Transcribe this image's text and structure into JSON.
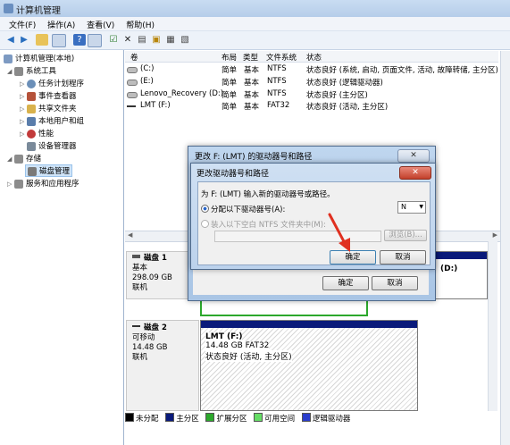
{
  "app": {
    "title": "计算机管理"
  },
  "menu": [
    "文件(F)",
    "操作(A)",
    "查看(V)",
    "帮助(H)"
  ],
  "tree": {
    "root": "计算机管理(本地)",
    "system_tools": "系统工具",
    "items": [
      "任务计划程序",
      "事件查看器",
      "共享文件夹",
      "本地用户和组",
      "性能",
      "设备管理器"
    ],
    "storage": "存储",
    "disk_mgmt": "磁盘管理",
    "services": "服务和应用程序"
  },
  "volumes": {
    "headers": [
      "卷",
      "布局",
      "类型",
      "文件系统",
      "状态"
    ],
    "rows": [
      [
        "(C:)",
        "简单",
        "基本",
        "NTFS",
        "状态良好 (系统, 启动, 页面文件, 活动, 故障转储, 主分区)"
      ],
      [
        "(E:)",
        "简单",
        "基本",
        "NTFS",
        "状态良好 (逻辑驱动器)"
      ],
      [
        "Lenovo_Recovery (D:)",
        "简单",
        "基本",
        "NTFS",
        "状态良好 (主分区)"
      ],
      [
        "LMT (F:)",
        "简单",
        "基本",
        "FAT32",
        "状态良好 (活动, 主分区)"
      ]
    ]
  },
  "disks": [
    {
      "name": "磁盘 1",
      "type": "基本",
      "size": "298.09 GB",
      "status": "联机",
      "part_label": "(D:)"
    },
    {
      "name": "磁盘 2",
      "type": "可移动",
      "size": "14.48 GB",
      "status": "联机",
      "part_name": "LMT  (F:)",
      "part_detail": "14.48 GB FAT32",
      "part_status": "状态良好 (活动, 主分区)"
    }
  ],
  "legend": [
    "未分配",
    "主分区",
    "扩展分区",
    "可用空间",
    "逻辑驱动器"
  ],
  "colors": {
    "unalloc": "#000000",
    "primary": "#0a1a7a",
    "extended": "#2ca82c",
    "free": "#66dd66",
    "logical": "#2a3dcc"
  },
  "dialog_back": {
    "title": "更改 F: (LMT) 的驱动器号和路径",
    "ok": "确定",
    "cancel": "取消"
  },
  "dialog_front": {
    "title": "更改驱动器号和路径",
    "prompt": "为 F: (LMT) 输入新的驱动器号或路径。",
    "opt1": "分配以下驱动器号(A):",
    "opt2": "装入以下空白 NTFS 文件夹中(M):",
    "letter": "N",
    "browse": "浏览(B)...",
    "ok": "确定",
    "cancel": "取消"
  }
}
